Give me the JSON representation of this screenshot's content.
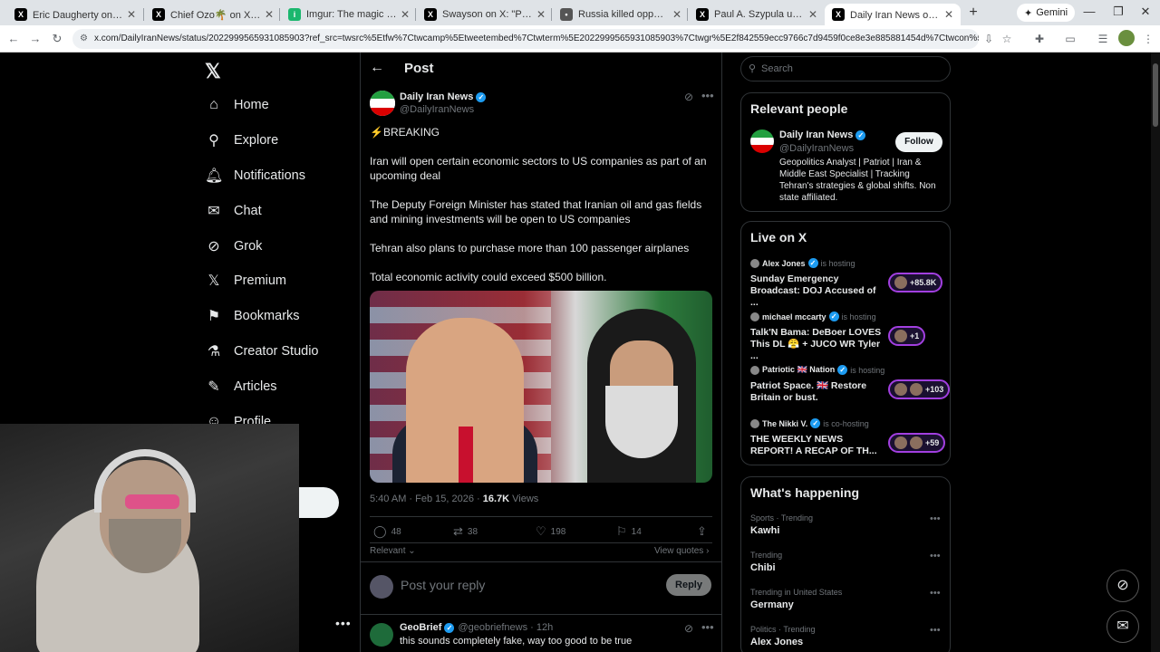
{
  "browser": {
    "tabs": [
      {
        "label": "Eric Daugherty on X: \"🚨 BRE",
        "fav": "X"
      },
      {
        "label": "Chief Ozo🌴 on X: \"A 68 yea",
        "fav": "X"
      },
      {
        "label": "Imgur: The magic of the Inte",
        "fav": "i"
      },
      {
        "label": "Swayson on X: \"Palantir surve",
        "fav": "X"
      },
      {
        "label": "Russia killed opposition leade",
        "fav": "•"
      },
      {
        "label": "Paul A. Szypula us on X: \"AOC",
        "fav": "X"
      },
      {
        "label": "Daily Iran News on X: \"⚡ BRE",
        "fav": "X"
      }
    ],
    "gemini_label": "Gemini",
    "url": "x.com/DailyIranNews/status/2022999565931085903?ref_src=twsrc%5Etfw%7Ctwcamp%5Etweetembed%7Ctwterm%5E2022999565931085903%7Ctwgr%5E2f842559ecc9766c7d9459f0ce8e3e885881454d%7Ctwcon%5Es1_&ref_url=http..."
  },
  "nav": {
    "items": [
      {
        "label": "Home",
        "icon": "home-icon"
      },
      {
        "label": "Explore",
        "icon": "search-icon"
      },
      {
        "label": "Notifications",
        "icon": "bell-icon"
      },
      {
        "label": "Chat",
        "icon": "mail-icon"
      },
      {
        "label": "Grok",
        "icon": "grok-icon"
      },
      {
        "label": "Premium",
        "icon": "x-icon"
      },
      {
        "label": "Bookmarks",
        "icon": "bookmark-icon"
      },
      {
        "label": "Creator Studio",
        "icon": "flask-icon"
      },
      {
        "label": "Articles",
        "icon": "article-icon"
      },
      {
        "label": "Profile",
        "icon": "person-icon"
      }
    ]
  },
  "post": {
    "header_title": "Post",
    "author_name": "Daily Iran News",
    "author_handle": "@DailyIranNews",
    "line1": "⚡BREAKING",
    "para1": "Iran will open certain economic sectors to US companies as part of an upcoming deal",
    "para2": "The Deputy Foreign Minister has stated that Iranian oil and gas fields and mining investments will be open to US companies",
    "para3": "Tehran also plans to purchase more than 100 passenger airplanes",
    "para4": "Total economic activity could exceed $500 billion.",
    "timestamp": "5:40 AM · Feb 15, 2026 · ",
    "views_count": "16.7K",
    "views_label": " Views",
    "replies": "48",
    "reposts": "38",
    "likes": "198",
    "bookmarks": "14",
    "sort_label": "Relevant ⌄",
    "view_quotes": "View quotes ›",
    "reply_placeholder": "Post your reply",
    "reply_button": "Reply"
  },
  "reply1": {
    "name": "GeoBrief",
    "handle": "@geobriefnews · 12h",
    "text": "this sounds completely fake, way too good to be true"
  },
  "sidebar": {
    "search_placeholder": "Search",
    "relevant": {
      "title": "Relevant people",
      "name": "Daily Iran News",
      "handle": "@DailyIranNews",
      "follow": "Follow",
      "bio": "Geopolitics Analyst | Patriot | Iran & Middle East Specialist | Tracking Tehran's strategies & global shifts. Non state affiliated."
    },
    "live": {
      "title": "Live on X",
      "items": [
        {
          "host": "Alex Jones",
          "role": "is hosting",
          "title": "Sunday Emergency Broadcast: DOJ Accused of ...",
          "count": "+85.8K"
        },
        {
          "host": "michael mccarty",
          "role": "is hosting",
          "title": "Talk'N Bama: DeBoer LOVES This DL 😤 + JUCO WR Tyler ...",
          "count": "+1"
        },
        {
          "host": "Patriotic 🇬🇧 Nation",
          "role": "is hosting",
          "title": "Patriot Space. 🇬🇧 Restore Britain or bust.",
          "count": "+103"
        },
        {
          "host": "The Nikki V.",
          "role": "is co-hosting",
          "title": "THE WEEKLY NEWS REPORT! A RECAP OF TH...",
          "count": "+59"
        }
      ]
    },
    "happening": {
      "title": "What's happening",
      "items": [
        {
          "category": "Sports · Trending",
          "name": "Kawhi"
        },
        {
          "category": "Trending",
          "name": "Chibi"
        },
        {
          "category": "Trending in United States",
          "name": "Germany"
        },
        {
          "category": "Politics · Trending",
          "name": "Alex Jones"
        }
      ]
    }
  },
  "colors": {
    "background": "#000000",
    "text": "#e7e9ea",
    "muted": "#71767b",
    "accent": "#1d9bf0",
    "live_ring": "#a23fe0"
  }
}
